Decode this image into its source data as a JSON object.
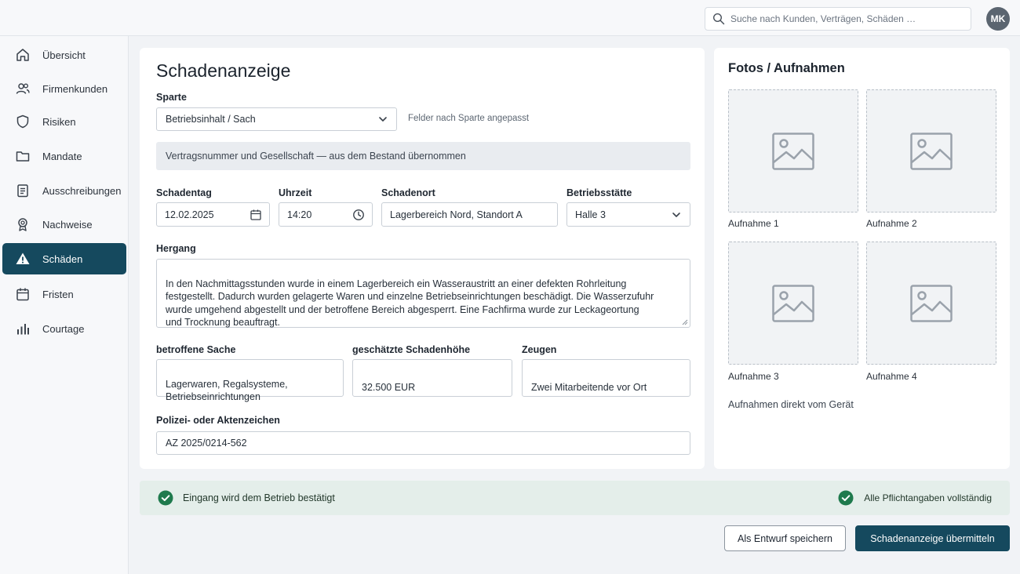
{
  "header": {
    "search_placeholder": "Suche nach Kunden, Verträgen, Schäden …",
    "avatar_initials": "MK"
  },
  "sidebar": {
    "items": [
      {
        "label": "Übersicht",
        "icon": "home-icon"
      },
      {
        "label": "Firmenkunden",
        "icon": "users-icon"
      },
      {
        "label": "Risiken",
        "icon": "shield-icon"
      },
      {
        "label": "Mandate",
        "icon": "folder-icon"
      },
      {
        "label": "Ausschreibungen",
        "icon": "clipboard-list-icon"
      },
      {
        "label": "Nachweise",
        "icon": "badge-icon"
      },
      {
        "label": "Schäden",
        "icon": "warning-icon",
        "active": true
      },
      {
        "label": "Fristen",
        "icon": "calendar-icon"
      },
      {
        "label": "Courtage",
        "icon": "bar-chart-icon"
      }
    ]
  },
  "form": {
    "title": "Schadenanzeige",
    "sparte": {
      "label": "Sparte",
      "value": "Betriebsinhalt / Sach",
      "hint": "Felder nach Sparte angepasst"
    },
    "info": "Vertragsnummer und Gesellschaft — aus dem Bestand übernommen",
    "schadentag": {
      "label": "Schadentag",
      "value": "12.02.2025"
    },
    "uhrzeit": {
      "label": "Uhrzeit",
      "value": "14:20"
    },
    "schadenort": {
      "label": "Schadenort",
      "value": "Lagerbereich Nord, Standort A"
    },
    "betriebsstaette": {
      "label": "Betriebsstätte",
      "value": "Halle 3"
    },
    "hergang": {
      "label": "Hergang",
      "value": "In den Nachmittagsstunden wurde in einem Lagerbereich ein Wasseraustritt an einer defekten Rohrleitung\nfestgestellt. Dadurch wurden gelagerte Waren und einzelne Betriebseinrichtungen beschädigt. Die Wasserzufuhr\nwurde umgehend abgestellt und der betroffene Bereich abgesperrt. Eine Fachfirma wurde zur Leckageortung\nund Trocknung beauftragt."
    },
    "betroffene_sache": {
      "label": "betroffene Sache",
      "value": "Lagerwaren, Regalsysteme,\nBetriebseinrichtungen"
    },
    "schadenhoehe": {
      "label": "geschätzte Schadenhöhe",
      "value": "32.500 EUR"
    },
    "zeugen": {
      "label": "Zeugen",
      "value": "Zwei Mitarbeitende vor Ort"
    },
    "aktenzeichen": {
      "label": "Polizei- oder Aktenzeichen",
      "value": "AZ 2025/0214-562"
    }
  },
  "photos": {
    "title": "Fotos / Aufnahmen",
    "slots": [
      {
        "caption": "Aufnahme 1"
      },
      {
        "caption": "Aufnahme 2"
      },
      {
        "caption": "Aufnahme 3"
      },
      {
        "caption": "Aufnahme 4"
      }
    ],
    "hint": "Aufnahmen direkt vom Gerät"
  },
  "status": {
    "left": "Eingang wird dem Betrieb bestätigt",
    "right": "Alle Pflichtangaben vollständig",
    "color": "#1f7a4d"
  },
  "actions": {
    "save_draft": "Als Entwurf speichern",
    "submit": "Schadenanzeige übermitteln"
  },
  "colors": {
    "accent": "#15495e",
    "success": "#1f7a4d"
  }
}
